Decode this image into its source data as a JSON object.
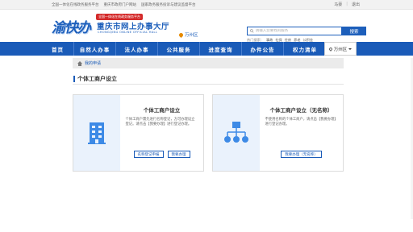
{
  "topbar": {
    "links": [
      "全国一体化在线政务服务平台",
      "重庆市政府门户网站",
      "国家政务服务投诉与建议监督平台"
    ],
    "login": "马豪",
    "logout": "退出"
  },
  "header": {
    "logo_word": "渝快办",
    "badge": "全国一体化在线政务服务平台",
    "title": "重庆市网上办事大厅",
    "subtitle": "CHONGQING ONLINE OFFICIAL HALL",
    "region": "万州区",
    "search_placeholder": "请输入您要找的服务",
    "search_button": "搜索",
    "hot_label": "热门搜索：",
    "hot_terms": [
      "事故",
      "社保",
      "住房",
      "养老",
      "公积金"
    ]
  },
  "nav": {
    "items": [
      "首页",
      "自然人办事",
      "法人办事",
      "公共服务",
      "进度查询",
      "办件公告",
      "权力清单"
    ],
    "region": "万州区"
  },
  "breadcrumb": {
    "label": "我的申请"
  },
  "page": {
    "title": "个体工商户设立"
  },
  "cards": [
    {
      "title": "个体工商户设立",
      "desc": "个体工商户需先进行名称登记，方可办理设立登记。请点击【我要办理】进行登记办理。",
      "buttons": [
        "名称登记申报",
        "我要办理"
      ]
    },
    {
      "title": "个体工商户设立（无名称）",
      "desc": "不使用名称的个体工商户，请点击【我要办理】进行登记办理。",
      "buttons": [
        "我要办理（无名称）"
      ]
    }
  ],
  "colors": {
    "brand": "#1a5bb8",
    "accent_red": "#d42a2a",
    "illus_bg": "#eaf2fc"
  }
}
